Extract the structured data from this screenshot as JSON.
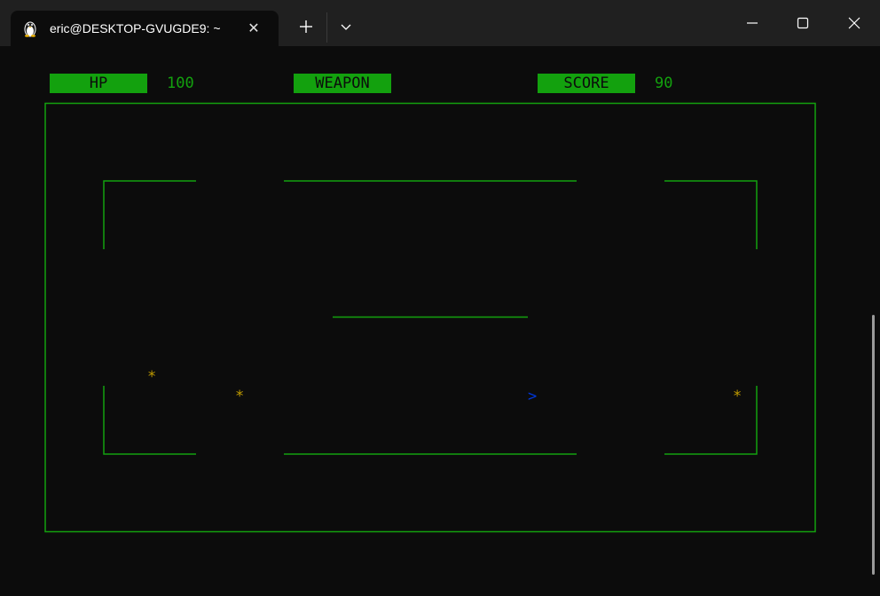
{
  "window": {
    "tab_title": "eric@DESKTOP-GVUGDE9: ~",
    "tab_icon": "linux-penguin-icon",
    "close_tab_glyph": "✕"
  },
  "hud": {
    "hp_label": "HP",
    "hp_value": "100",
    "weapon_label": "WEAPON",
    "weapon_value": "",
    "score_label": "SCORE",
    "score_value": "90"
  },
  "game": {
    "pickup_glyph": "*",
    "player_glyph": ">",
    "colors": {
      "wall": "#13a10e",
      "pickup": "#c19c00",
      "player": "#0037da",
      "background": "#0c0c0c"
    }
  }
}
